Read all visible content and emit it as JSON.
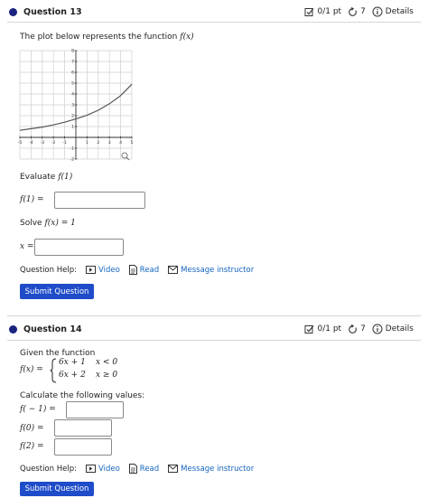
{
  "q13": {
    "title": "Question 13",
    "score": "0/1 pt",
    "retries": "7",
    "details": "Details",
    "prompt": "The plot below represents the function",
    "prompt_func": "f(x)",
    "evaluate_label": "Evaluate",
    "evaluate_func": "f(1)",
    "f1_label": "f(1) =",
    "solve_label": "Solve",
    "solve_eq": "f(x) = 1",
    "x_label": "x =",
    "help_label": "Question Help:",
    "video_label": "Video",
    "read_label": "Read",
    "message_label": "Message instructor",
    "submit_label": "Submit Question",
    "chart_data": {
      "type": "line",
      "title": "",
      "xlabel": "",
      "ylabel": "",
      "xlim": [
        -5,
        5
      ],
      "ylim": [
        -2,
        8
      ],
      "x_ticks": [
        "-5",
        "-4",
        "-3",
        "-2",
        "-1",
        "1",
        "2",
        "3",
        "4",
        "5"
      ],
      "y_ticks": [
        "-2",
        "-1",
        "1",
        "2",
        "3",
        "4",
        "5",
        "6",
        "7",
        "8"
      ],
      "grid": true,
      "series": [
        {
          "x": [
            -5,
            -4,
            -3,
            -2,
            -1,
            0,
            1,
            2,
            3,
            4,
            5
          ],
          "y": [
            0.65,
            0.8,
            0.95,
            1.15,
            1.4,
            1.7,
            2.05,
            2.5,
            3.1,
            3.85,
            4.9
          ]
        }
      ]
    }
  },
  "q14": {
    "title": "Question 14",
    "score": "0/1 pt",
    "retries": "7",
    "details": "Details",
    "given": "Given the function",
    "f_def": "f(x) =",
    "case1_expr": "6x + 1",
    "case1_cond": "x < 0",
    "case2_expr": "6x + 2",
    "case2_cond": "x ≥ 0",
    "calc_label": "Calculate the following values:",
    "fm1_label": "f( − 1) =",
    "f0_label": "f(0) =",
    "f2_label": "f(2) =",
    "help_label": "Question Help:",
    "video_label": "Video",
    "read_label": "Read",
    "message_label": "Message instructor",
    "submit_label": "Submit Question"
  }
}
